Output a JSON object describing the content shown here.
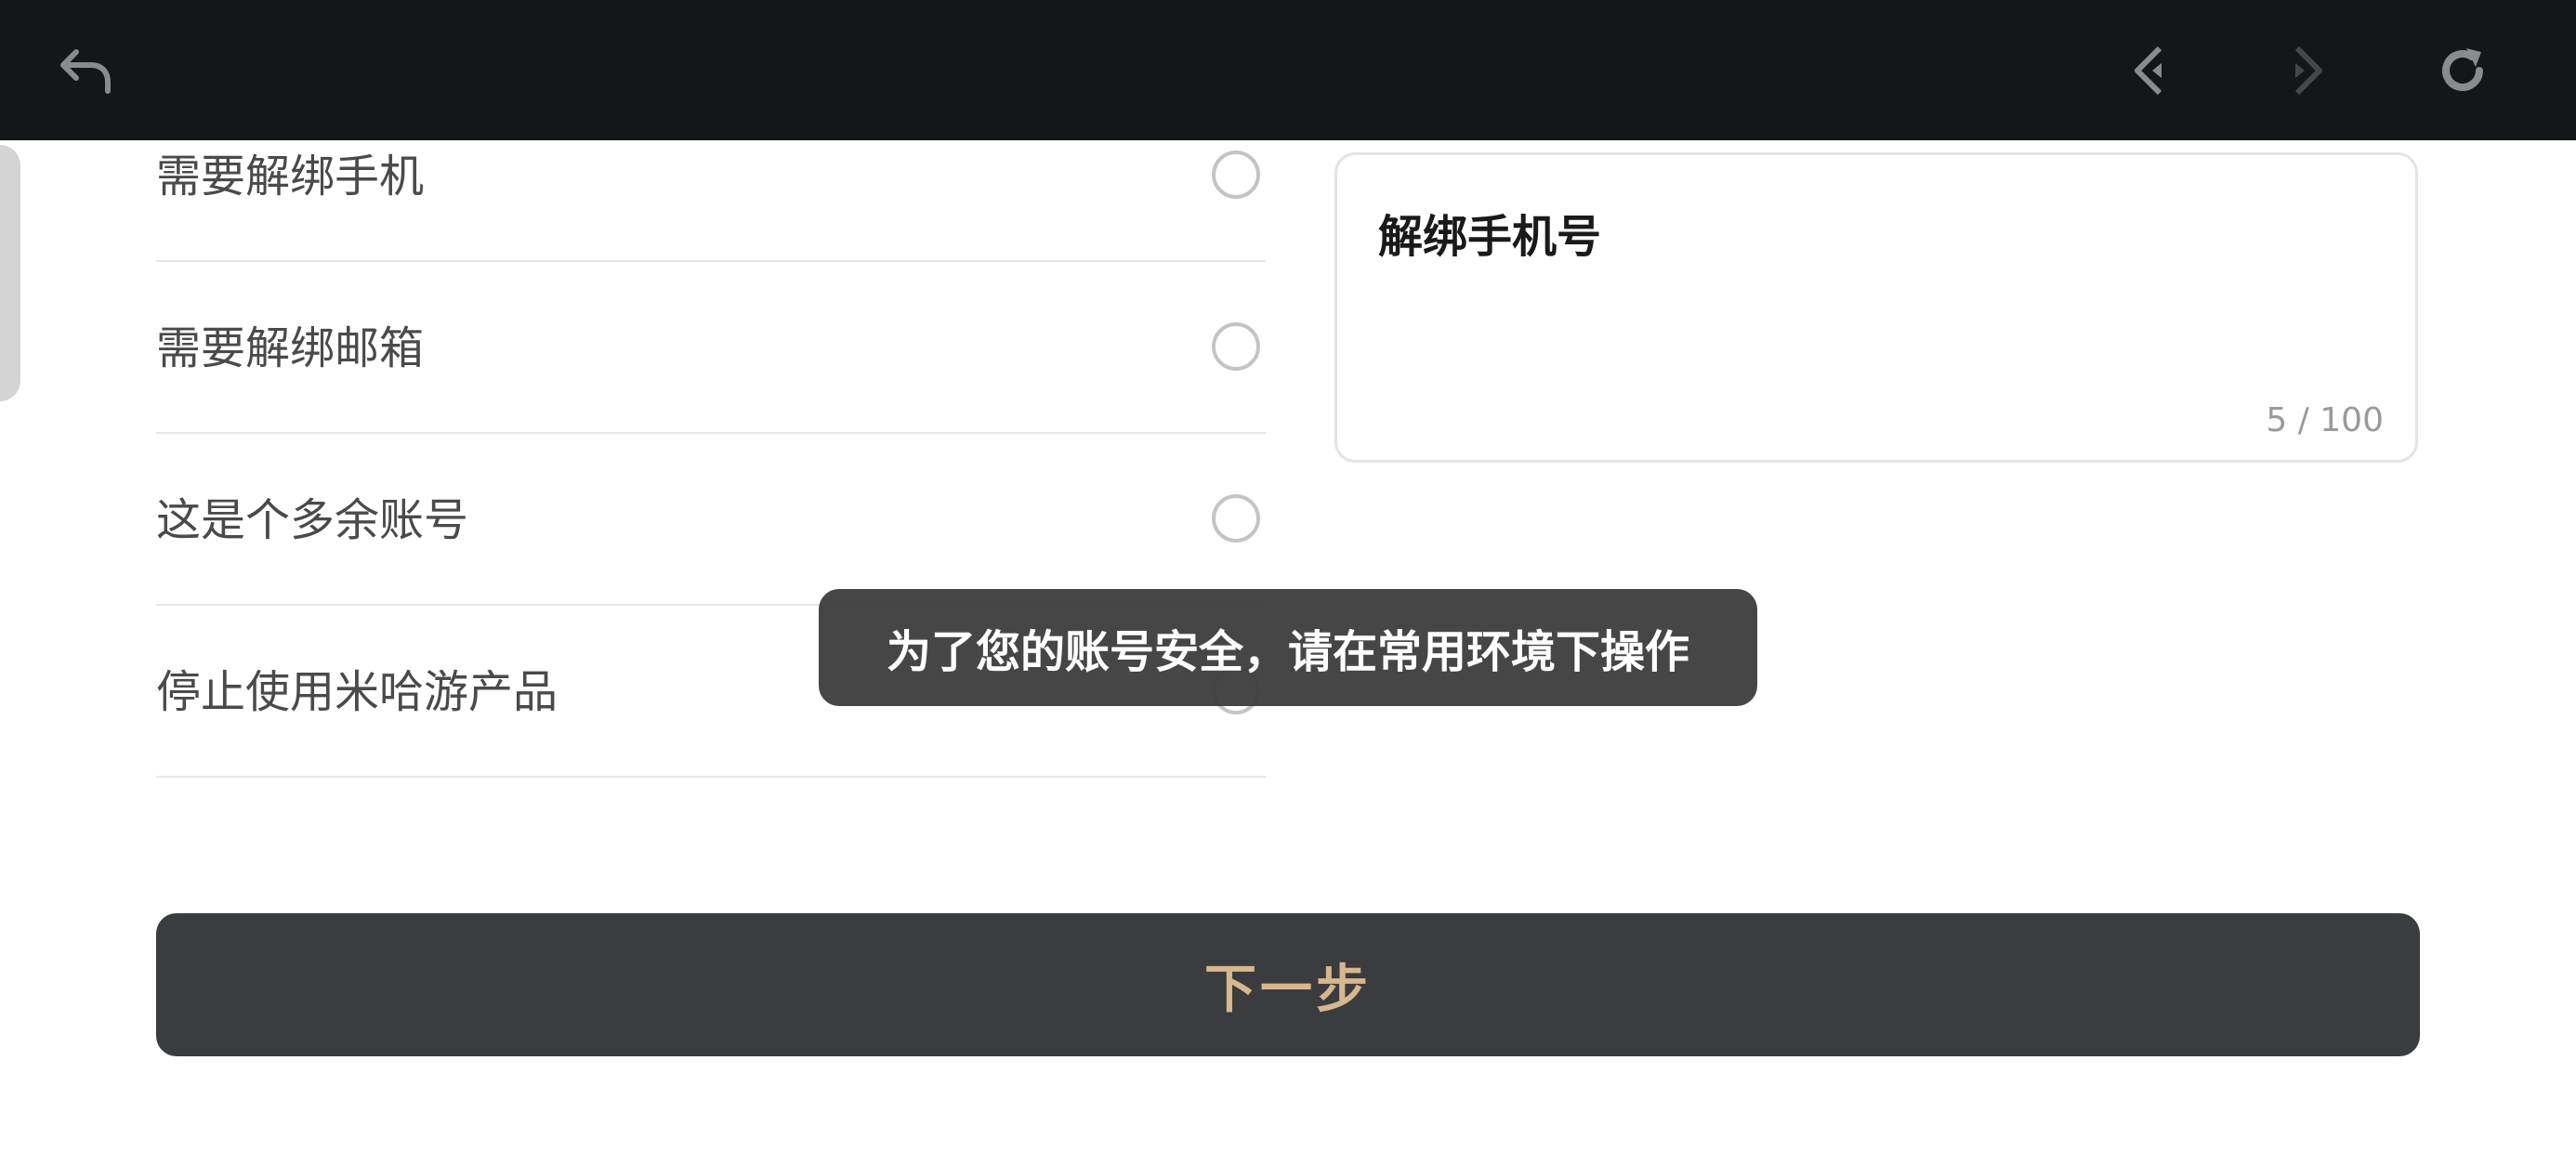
{
  "topbar": {
    "back_icon": "back-arrow-icon",
    "prev_icon": "chevron-left-icon",
    "next_icon": "chevron-right-icon",
    "refresh_icon": "refresh-icon",
    "background": "#151618"
  },
  "options": [
    {
      "label": "需要解绑手机"
    },
    {
      "label": "需要解绑邮箱"
    },
    {
      "label": "这是个多余账号"
    },
    {
      "label": "停止使用米哈游产品"
    }
  ],
  "reason_input": {
    "value": "解绑手机号",
    "counter": "5 / 100"
  },
  "toast": {
    "text": "为了您的账号安全，请在常用环境下操作"
  },
  "next_button": {
    "label": "下一步",
    "background": "#3b3c40",
    "text_color": "#d7b78d"
  }
}
